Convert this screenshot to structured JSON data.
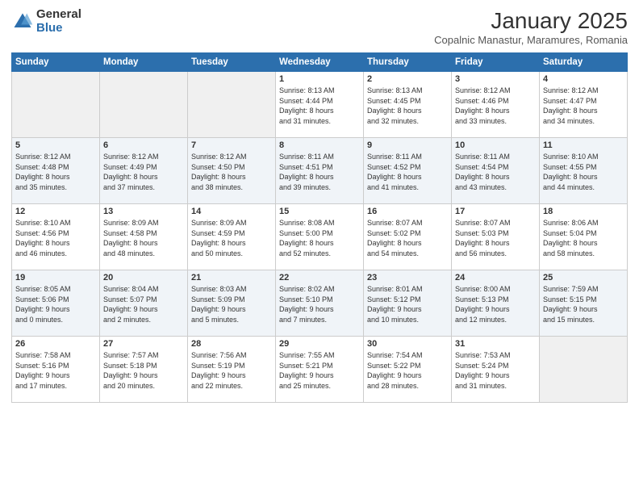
{
  "logo": {
    "general": "General",
    "blue": "Blue"
  },
  "title": "January 2025",
  "location": "Copalnic Manastur, Maramures, Romania",
  "weekdays": [
    "Sunday",
    "Monday",
    "Tuesday",
    "Wednesday",
    "Thursday",
    "Friday",
    "Saturday"
  ],
  "weeks": [
    [
      {
        "day": "",
        "info": ""
      },
      {
        "day": "",
        "info": ""
      },
      {
        "day": "",
        "info": ""
      },
      {
        "day": "1",
        "info": "Sunrise: 8:13 AM\nSunset: 4:44 PM\nDaylight: 8 hours\nand 31 minutes."
      },
      {
        "day": "2",
        "info": "Sunrise: 8:13 AM\nSunset: 4:45 PM\nDaylight: 8 hours\nand 32 minutes."
      },
      {
        "day": "3",
        "info": "Sunrise: 8:12 AM\nSunset: 4:46 PM\nDaylight: 8 hours\nand 33 minutes."
      },
      {
        "day": "4",
        "info": "Sunrise: 8:12 AM\nSunset: 4:47 PM\nDaylight: 8 hours\nand 34 minutes."
      }
    ],
    [
      {
        "day": "5",
        "info": "Sunrise: 8:12 AM\nSunset: 4:48 PM\nDaylight: 8 hours\nand 35 minutes."
      },
      {
        "day": "6",
        "info": "Sunrise: 8:12 AM\nSunset: 4:49 PM\nDaylight: 8 hours\nand 37 minutes."
      },
      {
        "day": "7",
        "info": "Sunrise: 8:12 AM\nSunset: 4:50 PM\nDaylight: 8 hours\nand 38 minutes."
      },
      {
        "day": "8",
        "info": "Sunrise: 8:11 AM\nSunset: 4:51 PM\nDaylight: 8 hours\nand 39 minutes."
      },
      {
        "day": "9",
        "info": "Sunrise: 8:11 AM\nSunset: 4:52 PM\nDaylight: 8 hours\nand 41 minutes."
      },
      {
        "day": "10",
        "info": "Sunrise: 8:11 AM\nSunset: 4:54 PM\nDaylight: 8 hours\nand 43 minutes."
      },
      {
        "day": "11",
        "info": "Sunrise: 8:10 AM\nSunset: 4:55 PM\nDaylight: 8 hours\nand 44 minutes."
      }
    ],
    [
      {
        "day": "12",
        "info": "Sunrise: 8:10 AM\nSunset: 4:56 PM\nDaylight: 8 hours\nand 46 minutes."
      },
      {
        "day": "13",
        "info": "Sunrise: 8:09 AM\nSunset: 4:58 PM\nDaylight: 8 hours\nand 48 minutes."
      },
      {
        "day": "14",
        "info": "Sunrise: 8:09 AM\nSunset: 4:59 PM\nDaylight: 8 hours\nand 50 minutes."
      },
      {
        "day": "15",
        "info": "Sunrise: 8:08 AM\nSunset: 5:00 PM\nDaylight: 8 hours\nand 52 minutes."
      },
      {
        "day": "16",
        "info": "Sunrise: 8:07 AM\nSunset: 5:02 PM\nDaylight: 8 hours\nand 54 minutes."
      },
      {
        "day": "17",
        "info": "Sunrise: 8:07 AM\nSunset: 5:03 PM\nDaylight: 8 hours\nand 56 minutes."
      },
      {
        "day": "18",
        "info": "Sunrise: 8:06 AM\nSunset: 5:04 PM\nDaylight: 8 hours\nand 58 minutes."
      }
    ],
    [
      {
        "day": "19",
        "info": "Sunrise: 8:05 AM\nSunset: 5:06 PM\nDaylight: 9 hours\nand 0 minutes."
      },
      {
        "day": "20",
        "info": "Sunrise: 8:04 AM\nSunset: 5:07 PM\nDaylight: 9 hours\nand 2 minutes."
      },
      {
        "day": "21",
        "info": "Sunrise: 8:03 AM\nSunset: 5:09 PM\nDaylight: 9 hours\nand 5 minutes."
      },
      {
        "day": "22",
        "info": "Sunrise: 8:02 AM\nSunset: 5:10 PM\nDaylight: 9 hours\nand 7 minutes."
      },
      {
        "day": "23",
        "info": "Sunrise: 8:01 AM\nSunset: 5:12 PM\nDaylight: 9 hours\nand 10 minutes."
      },
      {
        "day": "24",
        "info": "Sunrise: 8:00 AM\nSunset: 5:13 PM\nDaylight: 9 hours\nand 12 minutes."
      },
      {
        "day": "25",
        "info": "Sunrise: 7:59 AM\nSunset: 5:15 PM\nDaylight: 9 hours\nand 15 minutes."
      }
    ],
    [
      {
        "day": "26",
        "info": "Sunrise: 7:58 AM\nSunset: 5:16 PM\nDaylight: 9 hours\nand 17 minutes."
      },
      {
        "day": "27",
        "info": "Sunrise: 7:57 AM\nSunset: 5:18 PM\nDaylight: 9 hours\nand 20 minutes."
      },
      {
        "day": "28",
        "info": "Sunrise: 7:56 AM\nSunset: 5:19 PM\nDaylight: 9 hours\nand 22 minutes."
      },
      {
        "day": "29",
        "info": "Sunrise: 7:55 AM\nSunset: 5:21 PM\nDaylight: 9 hours\nand 25 minutes."
      },
      {
        "day": "30",
        "info": "Sunrise: 7:54 AM\nSunset: 5:22 PM\nDaylight: 9 hours\nand 28 minutes."
      },
      {
        "day": "31",
        "info": "Sunrise: 7:53 AM\nSunset: 5:24 PM\nDaylight: 9 hours\nand 31 minutes."
      },
      {
        "day": "",
        "info": ""
      }
    ]
  ]
}
